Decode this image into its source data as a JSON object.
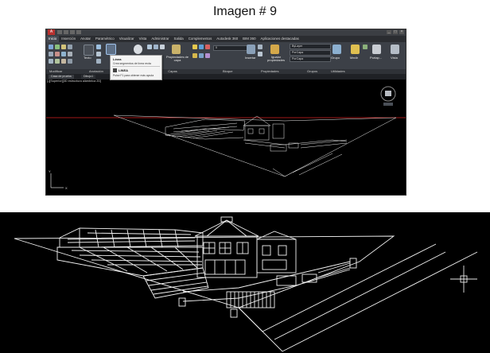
{
  "caption": "Imagen # 9",
  "app": {
    "menu_tabs": [
      "Inicio",
      "Inserción",
      "Anotar",
      "Paramétrico",
      "Visualizar",
      "Vista",
      "Administrar",
      "Salida",
      "Complementos",
      "Autodesk 360",
      "BIM 360",
      "Aplicaciones destacadas"
    ],
    "active_tab": "Inicio",
    "ribbon": {
      "draw_big_label": "Texto",
      "layers_label": "Propiedades de capa",
      "insert_label": "Insertar",
      "match_label": "Igualar propiedades",
      "color_value": "ByLayer",
      "linetype_value": "PorCapa",
      "lineweight_value": "PorCapa",
      "group_label": "Grupo",
      "measure_label": "Medir",
      "paste_label": "Portap...",
      "view_label": "Vista"
    },
    "panels": [
      "Modificar",
      "Anotación",
      "Capas",
      "Bloque",
      "Propiedades",
      "Grupos",
      "Utilidades"
    ],
    "file_tabs": [
      "Casa de prueba",
      "Dibujo1"
    ],
    "viewport_label": "[-][Superior][3D estructura alámbrica 2D]",
    "tooltip": {
      "title": "Línea",
      "description": "Crea segmentos de línea recta",
      "command": "LINEA",
      "help": "Pulse F1 para obtener más ayuda"
    },
    "ucs": {
      "x_label": "X",
      "y_label": "Y"
    }
  },
  "colors": {
    "ribbon_bg": "#3c4047",
    "viewport_bg": "#000000",
    "wire": "#f2f2f2",
    "red_axis": "#d81f1f",
    "accent": "#b8312f"
  }
}
